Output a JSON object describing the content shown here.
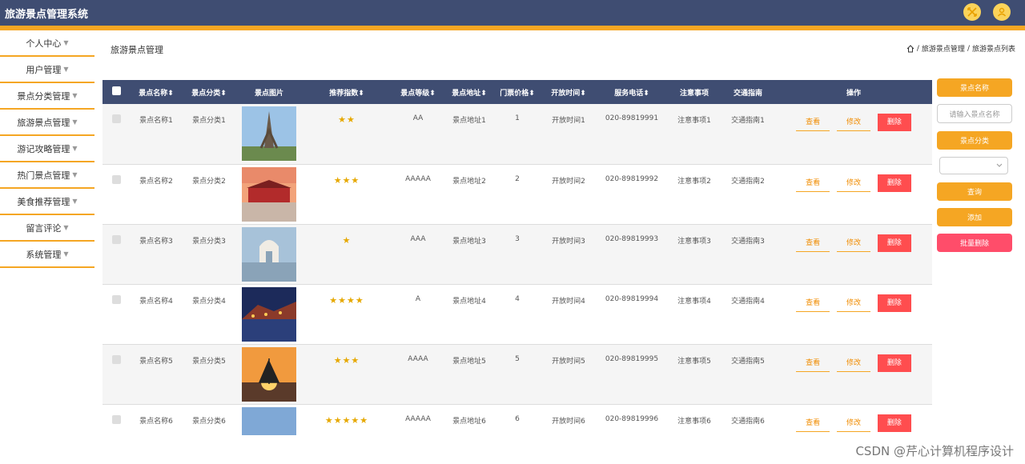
{
  "app": {
    "title": "旅游景点管理系统"
  },
  "sidebar": {
    "items": [
      {
        "label": "个人中心"
      },
      {
        "label": "用户管理"
      },
      {
        "label": "景点分类管理"
      },
      {
        "label": "旅游景点管理"
      },
      {
        "label": "游记攻略管理"
      },
      {
        "label": "热门景点管理"
      },
      {
        "label": "美食推荐管理"
      },
      {
        "label": "留言评论"
      },
      {
        "label": "系统管理"
      }
    ],
    "caret": "▼"
  },
  "page": {
    "title": "旅游景点管理"
  },
  "breadcrumb": {
    "items": [
      "旅游景点管理",
      "旅游景点列表"
    ],
    "sep": "/"
  },
  "table": {
    "headers": [
      "景点名称",
      "景点分类",
      "景点图片",
      "推荐指数",
      "景点等级",
      "景点地址",
      "门票价格",
      "开放时间",
      "服务电话",
      "注意事项",
      "交通指南",
      "操作"
    ],
    "sortable": [
      true,
      true,
      false,
      true,
      true,
      true,
      true,
      true,
      true,
      false,
      false,
      false
    ],
    "sort_glyph": "⬍",
    "rows": [
      {
        "name": "景点名称1",
        "cat": "景点分类1",
        "stars": "★★",
        "level": "AA",
        "addr": "景点地址1",
        "price": "1",
        "open": "开放时间1",
        "phone": "020-89819991",
        "note": "注意事项1",
        "traffic": "交通指南1",
        "img": "tower"
      },
      {
        "name": "景点名称2",
        "cat": "景点分类2",
        "stars": "★★★",
        "level": "AAAAA",
        "addr": "景点地址2",
        "price": "2",
        "open": "开放时间2",
        "phone": "020-89819992",
        "note": "注意事项2",
        "traffic": "交通指南2",
        "img": "gate"
      },
      {
        "name": "景点名称3",
        "cat": "景点分类3",
        "stars": "★",
        "level": "AAA",
        "addr": "景点地址3",
        "price": "3",
        "open": "开放时间3",
        "phone": "020-89819993",
        "note": "注意事项3",
        "traffic": "交通指南3",
        "img": "temple"
      },
      {
        "name": "景点名称4",
        "cat": "景点分类4",
        "stars": "★★★★",
        "level": "A",
        "addr": "景点地址4",
        "price": "4",
        "open": "开放时间4",
        "phone": "020-89819994",
        "note": "注意事项4",
        "traffic": "交通指南4",
        "img": "night"
      },
      {
        "name": "景点名称5",
        "cat": "景点分类5",
        "stars": "★★★",
        "level": "AAAA",
        "addr": "景点地址5",
        "price": "5",
        "open": "开放时间5",
        "phone": "020-89819995",
        "note": "注意事项5",
        "traffic": "交通指南5",
        "img": "sunset"
      },
      {
        "name": "景点名称6",
        "cat": "景点分类6",
        "stars": "★★★★★",
        "level": "AAAAA",
        "addr": "景点地址6",
        "price": "6",
        "open": "开放时间6",
        "phone": "020-89819996",
        "note": "注意事项6",
        "traffic": "交通指南6",
        "img": "opera"
      }
    ],
    "actions": {
      "view": "查看",
      "edit": "修改",
      "delete": "删除"
    }
  },
  "search": {
    "name_label": "景点名称",
    "name_placeholder": "请输入景点名称",
    "cat_label": "景点分类",
    "query": "查询",
    "add": "添加",
    "batch_delete": "批量删除"
  },
  "watermark": "CSDN @芹心计算机程序设计",
  "colors": {
    "header": "#3f4d72",
    "accent": "#f5a623",
    "danger": "#ff4d4f"
  }
}
